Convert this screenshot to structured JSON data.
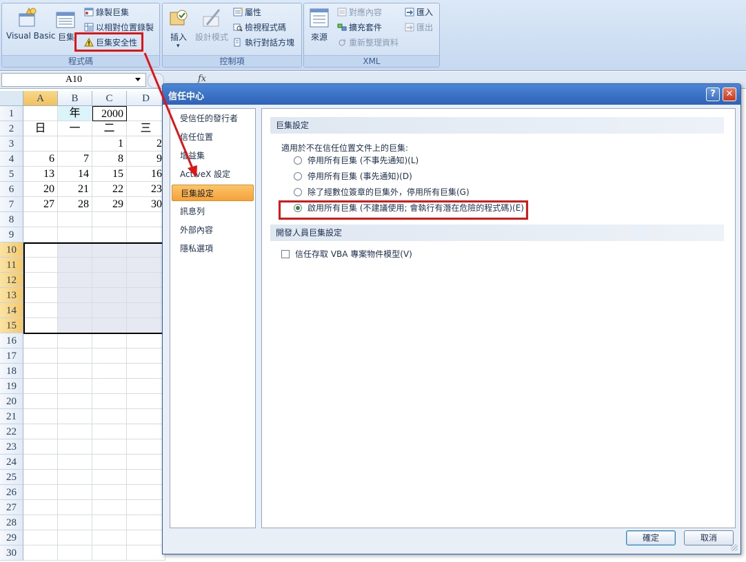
{
  "ribbon": {
    "groups": [
      {
        "label": "程式碼"
      },
      {
        "label": "控制項"
      },
      {
        "label": "XML"
      }
    ],
    "code": {
      "visual_basic": "Visual Basic",
      "macros_partial": "巨集",
      "record_macro": "錄製巨集",
      "relative_ref": "以相對位置錄製",
      "macro_security": "巨集安全性"
    },
    "controls": {
      "insert": "插入",
      "design_mode": "設計模式",
      "properties": "屬性",
      "view_code": "檢視程式碼",
      "run_dialog": "執行對話方塊"
    },
    "xml": {
      "source": "來源",
      "map_properties": "對應內容",
      "expansion_packs": "擴充套件",
      "refresh_data": "重新整理資料",
      "import": "匯入",
      "export": "匯出"
    }
  },
  "formula_bar": {
    "name_box": "A10",
    "fx": "fx"
  },
  "sheet": {
    "columns": [
      "A",
      "B",
      "C",
      "D"
    ],
    "rows": [
      "1",
      "2",
      "3",
      "4",
      "5",
      "6",
      "7",
      "8",
      "9",
      "10",
      "11",
      "12",
      "13",
      "14",
      "15",
      "16",
      "17",
      "18",
      "19",
      "20",
      "21",
      "22",
      "23",
      "24",
      "25",
      "26",
      "27",
      "28",
      "29",
      "30"
    ],
    "cells": [
      [
        "",
        "年",
        "2000",
        ""
      ],
      [
        "日",
        "一",
        "二",
        "三"
      ],
      [
        "",
        "",
        "1",
        "2"
      ],
      [
        "6",
        "7",
        "8",
        "9"
      ],
      [
        "13",
        "14",
        "15",
        "16"
      ],
      [
        "20",
        "21",
        "22",
        "23"
      ],
      [
        "27",
        "28",
        "29",
        "30"
      ]
    ]
  },
  "dialog": {
    "title": "信任中心",
    "help": "?",
    "nav": [
      "受信任的發行者",
      "信任位置",
      "增益集",
      "ActiveX 設定",
      "巨集設定",
      "訊息列",
      "外部內容",
      "隱私選項"
    ],
    "active_nav": "巨集設定",
    "section_macro": "巨集設定",
    "intro": "適用於不在信任位置文件上的巨集:",
    "options": [
      "停用所有巨集 (不事先通知)(L)",
      "停用所有巨集 (事先通知)(D)",
      "除了經數位簽章的巨集外，停用所有巨集(G)",
      "啟用所有巨集 (不建議使用; 會執行有潛在危險的程式碼)(E)"
    ],
    "selected_option": 3,
    "section_dev": "開發人員巨集設定",
    "trust_vba": "信任存取 VBA 專案物件模型(V)",
    "trust_vba_checked": false,
    "ok": "確定",
    "cancel": "取消"
  },
  "colors": {
    "highlight": "#e01414",
    "title_bar": "#2e62b8",
    "active_nav": "#f5a13a"
  }
}
